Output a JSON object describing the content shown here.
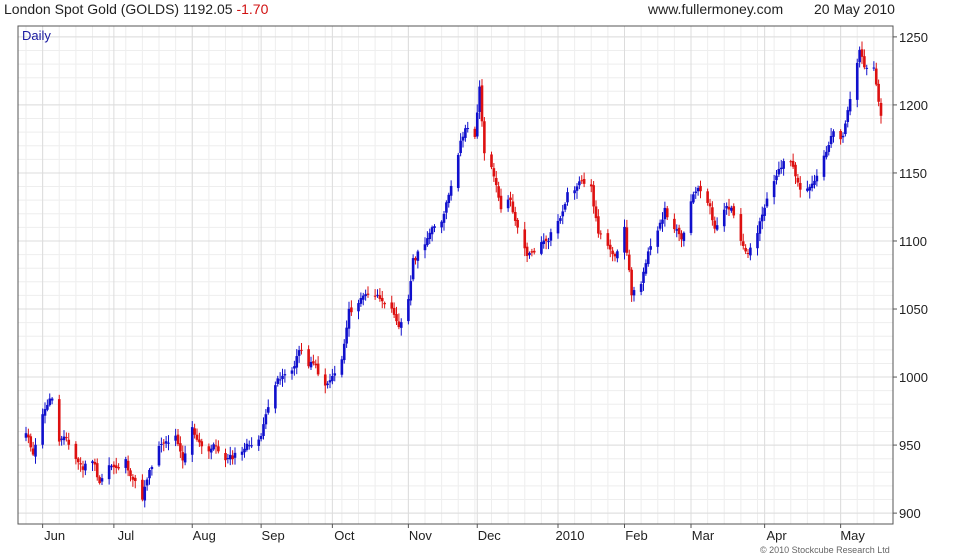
{
  "header": {
    "title": "London Spot Gold (GOLDS) 1192.05",
    "change": "-1.70",
    "site": "www.fullermoney.com",
    "date": "20 May 2010"
  },
  "footer": {
    "copyright": "© 2010 Stockcube Research Ltd"
  },
  "colors": {
    "up": "#1010cc",
    "down": "#dd1010",
    "grid": "#dcdcdc",
    "frame": "#555555",
    "period_label": "#1a1aa0",
    "change": "#d01010"
  },
  "chart_data": {
    "type": "candlestick",
    "period_label": "Daily",
    "ylim": [
      892,
      1258
    ],
    "y_ticks": [
      900,
      950,
      1000,
      1050,
      1100,
      1150,
      1200,
      1250
    ],
    "x_ticks": [
      "Jun",
      "Jul",
      "Aug",
      "Sep",
      "Oct",
      "Nov",
      "Dec",
      "2010",
      "Feb",
      "Mar",
      "Apr",
      "May"
    ],
    "grid": true,
    "y_axis_side": "right",
    "tick_dates": [
      "2009-06-01",
      "2009-07-01",
      "2009-08-03",
      "2009-09-01",
      "2009-10-01",
      "2009-11-02",
      "2009-12-01",
      "2010-01-04",
      "2010-02-01",
      "2010-03-01",
      "2010-04-01",
      "2010-05-03"
    ],
    "first_date": "2009-05-25",
    "last_date": "2010-05-20",
    "close_path": [
      [
        "2009-05-25",
        958
      ],
      [
        "2009-05-28",
        945
      ],
      [
        "2009-06-02",
        978
      ],
      [
        "2009-06-05",
        985
      ],
      [
        "2009-06-08",
        952
      ],
      [
        "2009-06-11",
        955
      ],
      [
        "2009-06-15",
        940
      ],
      [
        "2009-06-18",
        933
      ],
      [
        "2009-06-22",
        940
      ],
      [
        "2009-06-25",
        923
      ],
      [
        "2009-06-29",
        935
      ],
      [
        "2009-07-02",
        932
      ],
      [
        "2009-07-06",
        938
      ],
      [
        "2009-07-09",
        925
      ],
      [
        "2009-07-13",
        912
      ],
      [
        "2009-07-16",
        930
      ],
      [
        "2009-07-20",
        948
      ],
      [
        "2009-07-23",
        952
      ],
      [
        "2009-07-27",
        955
      ],
      [
        "2009-07-30",
        938
      ],
      [
        "2009-08-03",
        962
      ],
      [
        "2009-08-06",
        952
      ],
      [
        "2009-08-10",
        946
      ],
      [
        "2009-08-13",
        950
      ],
      [
        "2009-08-17",
        938
      ],
      [
        "2009-08-20",
        942
      ],
      [
        "2009-08-25",
        948
      ],
      [
        "2009-08-28",
        952
      ],
      [
        "2009-09-01",
        955
      ],
      [
        "2009-09-03",
        975
      ],
      [
        "2009-09-07",
        995
      ],
      [
        "2009-09-10",
        1000
      ],
      [
        "2009-09-14",
        1005
      ],
      [
        "2009-09-17",
        1020
      ],
      [
        "2009-09-21",
        1010
      ],
      [
        "2009-09-24",
        1008
      ],
      [
        "2009-09-28",
        992
      ],
      [
        "2009-10-01",
        1000
      ],
      [
        "2009-10-05",
        1012
      ],
      [
        "2009-10-08",
        1048
      ],
      [
        "2009-10-12",
        1055
      ],
      [
        "2009-10-15",
        1062
      ],
      [
        "2009-10-19",
        1060
      ],
      [
        "2009-10-22",
        1058
      ],
      [
        "2009-10-26",
        1048
      ],
      [
        "2009-10-29",
        1035
      ],
      [
        "2009-11-02",
        1058
      ],
      [
        "2009-11-04",
        1085
      ],
      [
        "2009-11-09",
        1100
      ],
      [
        "2009-11-12",
        1108
      ],
      [
        "2009-11-16",
        1115
      ],
      [
        "2009-11-19",
        1135
      ],
      [
        "2009-11-23",
        1165
      ],
      [
        "2009-11-26",
        1185
      ],
      [
        "2009-11-30",
        1175
      ],
      [
        "2009-12-02",
        1212
      ],
      [
        "2009-12-04",
        1165
      ],
      [
        "2009-12-08",
        1148
      ],
      [
        "2009-12-11",
        1125
      ],
      [
        "2009-12-15",
        1130
      ],
      [
        "2009-12-18",
        1108
      ],
      [
        "2009-12-22",
        1088
      ],
      [
        "2009-12-28",
        1098
      ],
      [
        "2009-12-31",
        1102
      ],
      [
        "2010-01-05",
        1118
      ],
      [
        "2010-01-08",
        1135
      ],
      [
        "2010-01-12",
        1140
      ],
      [
        "2010-01-14",
        1145
      ],
      [
        "2010-01-18",
        1138
      ],
      [
        "2010-01-21",
        1105
      ],
      [
        "2010-01-25",
        1098
      ],
      [
        "2010-01-28",
        1090
      ],
      [
        "2010-02-01",
        1108
      ],
      [
        "2010-02-04",
        1062
      ],
      [
        "2010-02-08",
        1068
      ],
      [
        "2010-02-11",
        1090
      ],
      [
        "2010-02-15",
        1110
      ],
      [
        "2010-02-18",
        1122
      ],
      [
        "2010-02-22",
        1110
      ],
      [
        "2010-02-25",
        1100
      ],
      [
        "2010-03-01",
        1128
      ],
      [
        "2010-03-04",
        1140
      ],
      [
        "2010-03-08",
        1130
      ],
      [
        "2010-03-11",
        1110
      ],
      [
        "2010-03-15",
        1125
      ],
      [
        "2010-03-18",
        1125
      ],
      [
        "2010-03-22",
        1100
      ],
      [
        "2010-03-25",
        1090
      ],
      [
        "2010-03-29",
        1106
      ],
      [
        "2010-04-01",
        1125
      ],
      [
        "2010-04-06",
        1148
      ],
      [
        "2010-04-09",
        1160
      ],
      [
        "2010-04-13",
        1155
      ],
      [
        "2010-04-16",
        1140
      ],
      [
        "2010-04-20",
        1140
      ],
      [
        "2010-04-23",
        1148
      ],
      [
        "2010-04-27",
        1165
      ],
      [
        "2010-04-30",
        1180
      ],
      [
        "2010-05-04",
        1175
      ],
      [
        "2010-05-07",
        1205
      ],
      [
        "2010-05-11",
        1240
      ],
      [
        "2010-05-13",
        1230
      ],
      [
        "2010-05-17",
        1225
      ],
      [
        "2010-05-19",
        1200
      ],
      [
        "2010-05-20",
        1192
      ]
    ]
  }
}
